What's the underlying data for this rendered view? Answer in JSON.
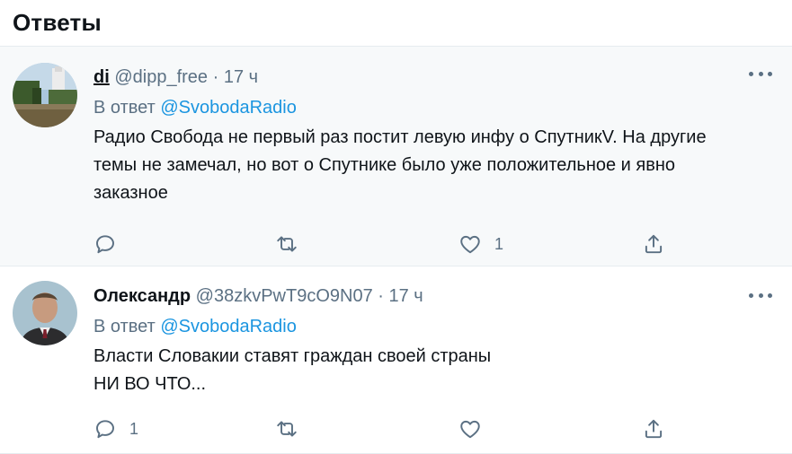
{
  "header": {
    "title": "Ответы"
  },
  "tweets": [
    {
      "name": "di",
      "handle": "@dipp_free",
      "time": "· 17 ч",
      "replying_prefix": "В ответ",
      "replying_to": "@SvobodaRadio",
      "text": "Радио Свобода не первый раз постит левую инфу о СпутникV. На другие\nтемы не замечал, но вот о Спутнике было уже положительное и  явно\nзаказное",
      "reply_count": "",
      "retweet_count": "",
      "like_count": "1"
    },
    {
      "name": "Олександр",
      "handle": "@38zkvPwT9cO9N07",
      "time": "· 17 ч",
      "replying_prefix": "В ответ",
      "replying_to": "@SvobodaRadio",
      "text": "Власти Словакии ставят граждан своей страны\nНИ ВО ЧТО...",
      "reply_count": "1",
      "retweet_count": "",
      "like_count": ""
    }
  ],
  "icons": {
    "more": "more-horizontal-icon",
    "reply": "reply-icon",
    "retweet": "retweet-icon",
    "like": "heart-icon",
    "share": "share-icon"
  },
  "colors": {
    "mention": "#1b95e0",
    "secondary_text": "#5b7083",
    "highlight_background": "#f7f9fa",
    "divider": "#e6ecf0"
  }
}
